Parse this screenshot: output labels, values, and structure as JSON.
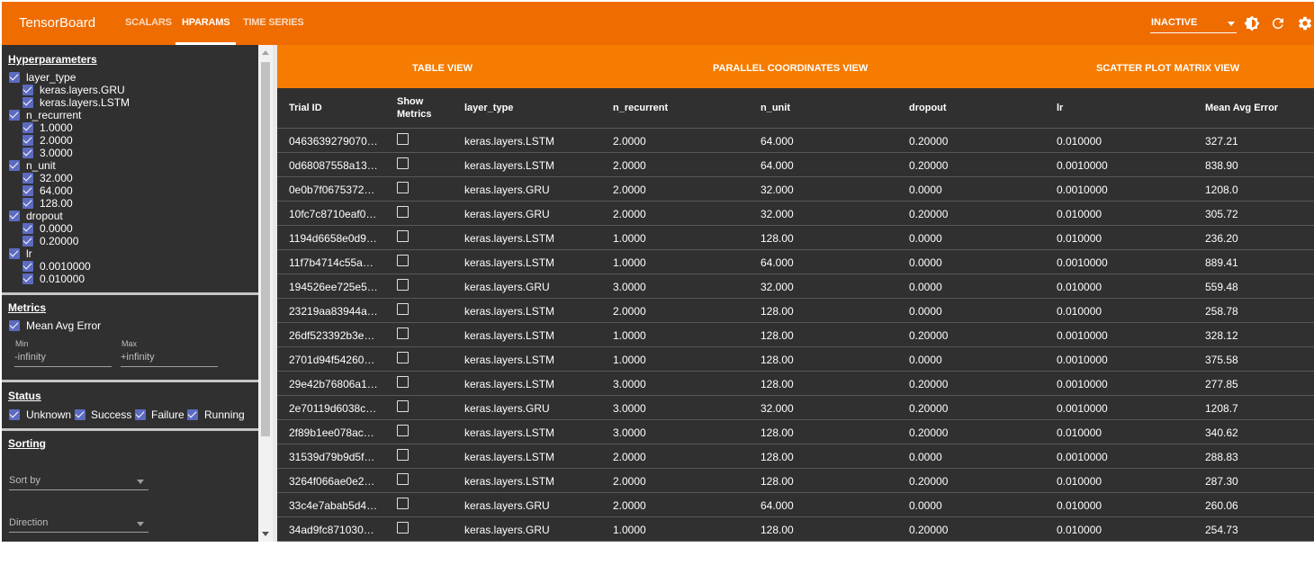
{
  "app": {
    "title": "TensorBoard"
  },
  "nav": {
    "tabs": [
      "SCALARS",
      "HPARAMS",
      "TIME SERIES"
    ],
    "active": "HPARAMS"
  },
  "topbar": {
    "run_state": "INACTIVE",
    "icons": [
      "theme-toggle-icon",
      "refresh-icon",
      "settings-gear-icon"
    ]
  },
  "sidebar": {
    "hyperparameters": {
      "title": "Hyperparameters",
      "params": [
        {
          "name": "layer_type",
          "values": [
            "keras.layers.GRU",
            "keras.layers.LSTM"
          ]
        },
        {
          "name": "n_recurrent",
          "values": [
            "1.0000",
            "2.0000",
            "3.0000"
          ]
        },
        {
          "name": "n_unit",
          "values": [
            "32.000",
            "64.000",
            "128.00"
          ]
        },
        {
          "name": "dropout",
          "values": [
            "0.0000",
            "0.20000"
          ]
        },
        {
          "name": "lr",
          "values": [
            "0.0010000",
            "0.010000"
          ]
        }
      ]
    },
    "metrics": {
      "title": "Metrics",
      "metric": "Mean Avg Error",
      "min_label": "Min",
      "max_label": "Max",
      "min_value": "-infinity",
      "max_value": "+infinity"
    },
    "status": {
      "title": "Status",
      "options": [
        "Unknown",
        "Success",
        "Failure",
        "Running"
      ]
    },
    "sorting": {
      "title": "Sorting",
      "sort_by_placeholder": "Sort by",
      "direction_placeholder": "Direction"
    }
  },
  "view_tabs": [
    "TABLE VIEW",
    "PARALLEL COORDINATES VIEW",
    "SCATTER PLOT MATRIX VIEW"
  ],
  "table": {
    "columns": [
      "Trial ID",
      "Show Metrics",
      "layer_type",
      "n_recurrent",
      "n_unit",
      "dropout",
      "lr",
      "Mean Avg Error"
    ],
    "rows": [
      [
        "0463639279070…",
        "keras.layers.LSTM",
        "2.0000",
        "64.000",
        "0.20000",
        "0.010000",
        "327.21"
      ],
      [
        "0d68087558a13…",
        "keras.layers.LSTM",
        "2.0000",
        "64.000",
        "0.20000",
        "0.0010000",
        "838.90"
      ],
      [
        "0e0b7f0675372…",
        "keras.layers.GRU",
        "2.0000",
        "32.000",
        "0.0000",
        "0.0010000",
        "1208.0"
      ],
      [
        "10fc7c8710eaf0…",
        "keras.layers.GRU",
        "2.0000",
        "32.000",
        "0.20000",
        "0.010000",
        "305.72"
      ],
      [
        "1194d6658e0d9…",
        "keras.layers.LSTM",
        "1.0000",
        "128.00",
        "0.0000",
        "0.010000",
        "236.20"
      ],
      [
        "11f7b4714c55a…",
        "keras.layers.LSTM",
        "1.0000",
        "64.000",
        "0.0000",
        "0.0010000",
        "889.41"
      ],
      [
        "194526ee725e5…",
        "keras.layers.GRU",
        "3.0000",
        "32.000",
        "0.0000",
        "0.010000",
        "559.48"
      ],
      [
        "23219aa83944a…",
        "keras.layers.LSTM",
        "2.0000",
        "128.00",
        "0.0000",
        "0.010000",
        "258.78"
      ],
      [
        "26df523392b3e…",
        "keras.layers.LSTM",
        "1.0000",
        "128.00",
        "0.20000",
        "0.0010000",
        "328.12"
      ],
      [
        "2701d94f54260…",
        "keras.layers.LSTM",
        "1.0000",
        "128.00",
        "0.0000",
        "0.0010000",
        "375.58"
      ],
      [
        "29e42b76806a1…",
        "keras.layers.LSTM",
        "3.0000",
        "128.00",
        "0.20000",
        "0.0010000",
        "277.85"
      ],
      [
        "2e70119d6038c…",
        "keras.layers.GRU",
        "3.0000",
        "32.000",
        "0.20000",
        "0.0010000",
        "1208.7"
      ],
      [
        "2f89b1ee078ac…",
        "keras.layers.LSTM",
        "3.0000",
        "128.00",
        "0.20000",
        "0.010000",
        "340.62"
      ],
      [
        "31539d79b9d5f…",
        "keras.layers.LSTM",
        "2.0000",
        "128.00",
        "0.0000",
        "0.0010000",
        "288.83"
      ],
      [
        "3264f066ae0e2…",
        "keras.layers.LSTM",
        "2.0000",
        "128.00",
        "0.20000",
        "0.010000",
        "287.30"
      ],
      [
        "33c4e7abab5d4…",
        "keras.layers.GRU",
        "2.0000",
        "64.000",
        "0.0000",
        "0.010000",
        "260.06"
      ],
      [
        "34ad9fc871030…",
        "keras.layers.GRU",
        "1.0000",
        "128.00",
        "0.20000",
        "0.010000",
        "254.73"
      ]
    ]
  },
  "colors": {
    "topbar": "#ef6c00",
    "viewtabs": "#f57c00",
    "background": "#303030",
    "checkbox": "#5c6bc0"
  }
}
